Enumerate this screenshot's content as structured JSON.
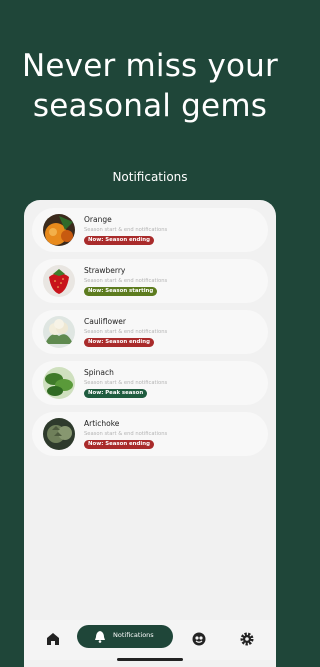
{
  "headline": {
    "line1": "Never miss your",
    "line2": "seasonal gems"
  },
  "screen_title": "Notifications",
  "notifications": [
    {
      "name": "Orange",
      "subtitle": "Season start & end notifications",
      "status": "Now: Season ending",
      "status_color": "#a92b2b",
      "icon": "orange-image"
    },
    {
      "name": "Strawberry",
      "subtitle": "Season start & end notifications",
      "status": "Now: Season starting",
      "status_color": "#5d7c1f",
      "icon": "strawberry-image"
    },
    {
      "name": "Cauliflower",
      "subtitle": "Season start & end notifications",
      "status": "Now: Season ending",
      "status_color": "#a92b2b",
      "icon": "cauliflower-image"
    },
    {
      "name": "Spinach",
      "subtitle": "Season start & end notifications",
      "status": "Now: Peak season",
      "status_color": "#1f5c3f",
      "icon": "spinach-image"
    },
    {
      "name": "Artichoke",
      "subtitle": "Season start & end notifications",
      "status": "Now: Season ending",
      "status_color": "#a92b2b",
      "icon": "artichoke-image"
    }
  ],
  "bottom_nav": {
    "active_label": "Notifications",
    "items": [
      "home-icon",
      "bell-icon",
      "produce-icon",
      "settings-icon"
    ]
  },
  "colors": {
    "background": "#1f4639",
    "ending": "#a92b2b",
    "starting": "#5d7c1f",
    "peak": "#1f5c3f"
  }
}
